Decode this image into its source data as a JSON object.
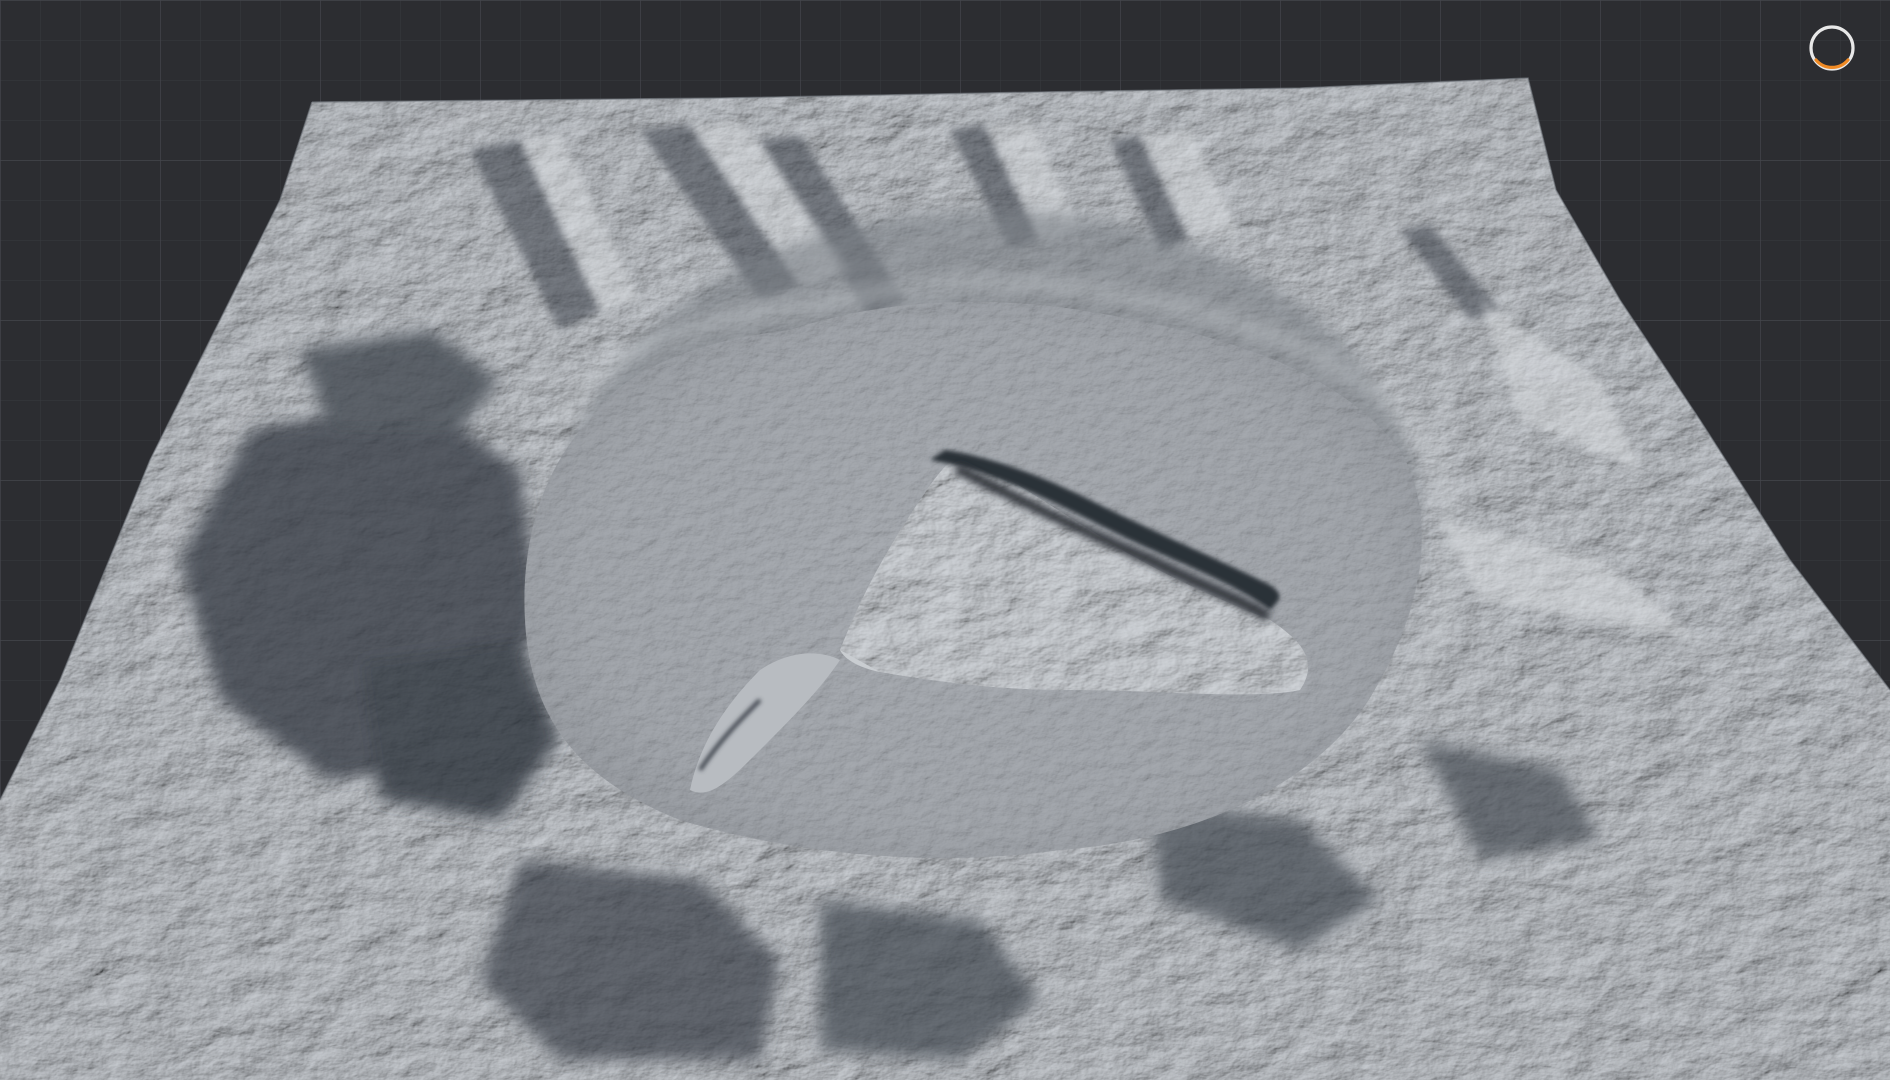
{
  "viewport": {
    "view_mode": "perspective",
    "grid_visible": true,
    "object": "terrain-mesh",
    "shading": "gray clay",
    "background_color": "#2c2d31",
    "grid_color": "#3e4046"
  },
  "gizmo": {
    "icon": "orbit-gizmo-icon",
    "ring_color": "#e8e8e8",
    "accent_color": "#f08a24"
  }
}
